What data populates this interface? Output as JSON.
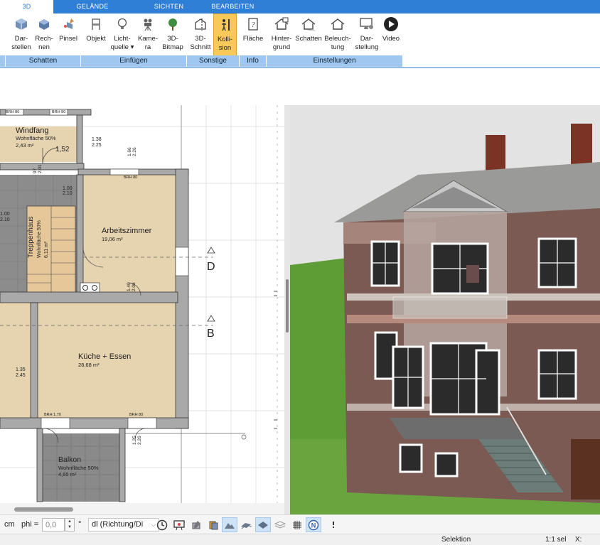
{
  "tabs": [
    {
      "label": "3D",
      "active": true
    },
    {
      "label": "GELÄNDE"
    },
    {
      "label": "SICHTEN"
    },
    {
      "label": "BEARBEITEN"
    }
  ],
  "ribbon": {
    "buttons": [
      {
        "line1": "Dar-",
        "line2": "stellen",
        "icon": "cube-display-icon"
      },
      {
        "line1": "Rech-",
        "line2": "nen",
        "icon": "cube-render-icon"
      },
      {
        "line1": "Pinsel",
        "line2": "",
        "icon": "brush-cube-icon"
      },
      {
        "line1": "Objekt",
        "line2": "",
        "icon": "chair-icon"
      },
      {
        "line1": "Licht-",
        "line2": "quelle ▾",
        "icon": "light-bulb-icon"
      },
      {
        "line1": "Kame-",
        "line2": "ra",
        "icon": "camera-icon"
      },
      {
        "line1": "3D-",
        "line2": "Bitmap",
        "icon": "tree-icon"
      },
      {
        "line1": "3D-",
        "line2": "Schnitt",
        "icon": "section-cut-icon"
      },
      {
        "line1": "Kolli-",
        "line2": "sion",
        "icon": "person-collision-icon",
        "active": true
      },
      {
        "line1": "Fläche",
        "line2": "",
        "icon": "area-info-icon"
      },
      {
        "line1": "Hinter-",
        "line2": "grund",
        "icon": "house-background-icon"
      },
      {
        "line1": "Schatten",
        "line2": "",
        "icon": "house-shadow-icon"
      },
      {
        "line1": "Beleuch-",
        "line2": "tung",
        "icon": "house-lighting-icon"
      },
      {
        "line1": "Dar-",
        "line2": "stellung",
        "icon": "monitor-settings-icon"
      },
      {
        "line1": "Video",
        "line2": "",
        "icon": "play-video-icon"
      }
    ],
    "groups": [
      "Schatten",
      "Einfügen",
      "Sonstige",
      "Info",
      "Einstellungen"
    ]
  },
  "plan": {
    "rooms": [
      {
        "name": "Windfang",
        "area": "Wohnfläche 50%",
        "size": "2,43 m²"
      },
      {
        "name": "Arbeitszimmer",
        "area": "",
        "size": "19,06 m²"
      },
      {
        "name": "Treppenhaus",
        "area": "Wohnfläche 50%",
        "size": "6,11 m²"
      },
      {
        "name": "Küche + Essen",
        "area": "",
        "size": "28,68 m²"
      },
      {
        "name": "Balkon",
        "area": "Wohnfläche 50%",
        "size": "4,65 m²"
      }
    ],
    "labels": {
      "brh80_a": "BRH 80",
      "brh80_b": "BRH 80",
      "brh80_c": "BRH 80",
      "brh80_d": "BRH 80",
      "brh170": "BRH 1.70",
      "d152": "1,52",
      "d138": "1.38",
      "d225": "2.25",
      "d166": "1.66",
      "d226": "2.26",
      "d100a": "1.00",
      "d210a": "2.10",
      "d100b": "1.00",
      "d210b": "2.10",
      "d135": "1.35",
      "d245": "2.45",
      "d140": "1.40",
      "d206": "2.06",
      "d125": "1.25",
      "d226b": "2.26",
      "d097": "97",
      "d201": "2.01",
      "section_d": "D",
      "section_b": "B"
    }
  },
  "toolbar": {
    "unit": "cm",
    "phi_label": "phi =",
    "phi_value": "0,0",
    "degree": "°",
    "dl_value": "dl (Richtung/Di",
    "icons": [
      "clock-icon",
      "presentation-icon",
      "pencil-layers-icon",
      "stack-icon",
      "terrain-icon",
      "tiles-icon",
      "plane-icon",
      "layers-icon",
      "grid-icon",
      "north-icon",
      "more-vertical-icon"
    ]
  },
  "status": {
    "mode": "Selektion",
    "scale": "1:1 sel",
    "x_label": "X:"
  },
  "colors": {
    "accent": "#2f7fd6",
    "group_bar": "#9fc7ef",
    "active_button": "#f8c95a",
    "wood_floor": "#e6d3b0",
    "tile_floor": "#8c8c8c"
  }
}
